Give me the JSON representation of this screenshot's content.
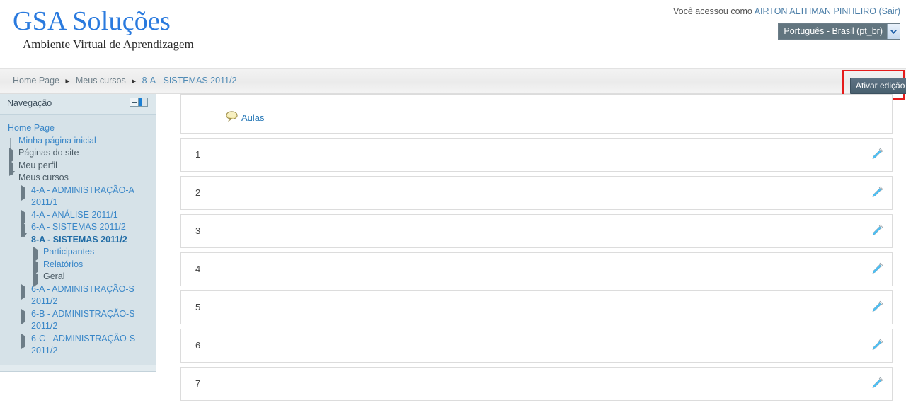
{
  "header": {
    "brand_title": "GSA Soluções",
    "brand_subtitle": "Ambiente Virtual de Aprendizagem",
    "login_prefix": "Você acessou como",
    "user_name": "AIRTON ALTHMAN PINHEIRO",
    "logout_label": "(Sair)",
    "language_selected": "Português - Brasil (pt_br)",
    "language_icon": "chevron-down-icon"
  },
  "breadcrumb": {
    "separator": "►",
    "items": [
      {
        "label": "Home Page",
        "type": "link"
      },
      {
        "label": "Meus cursos",
        "type": "link"
      },
      {
        "label": "8-A - SISTEMAS 2011/2",
        "type": "current"
      }
    ]
  },
  "toolbar": {
    "edit_button_label": "Ativar edição",
    "highlight_color": "#e51b1b"
  },
  "sidebar": {
    "block_title": "Navegação",
    "collapse_icon": "minus-icon",
    "dock_icon": "dock-icon",
    "items": [
      {
        "label": "Home Page",
        "level": 0,
        "twisty": "none",
        "style": "link"
      },
      {
        "label": "Minha página inicial",
        "level": 1,
        "twisty": "dot",
        "style": "link"
      },
      {
        "label": "Páginas do site",
        "level": 1,
        "twisty": "right",
        "style": "text"
      },
      {
        "label": "Meu perfil",
        "level": 1,
        "twisty": "right",
        "style": "text"
      },
      {
        "label": "Meus cursos",
        "level": 1,
        "twisty": "down",
        "style": "text"
      },
      {
        "label": "4-A - ADMINISTRAÇÃO-A 2011/1",
        "level": 2,
        "twisty": "right",
        "style": "link"
      },
      {
        "label": "4-A - ANÁLISE 2011/1",
        "level": 2,
        "twisty": "right",
        "style": "link"
      },
      {
        "label": "6-A - SISTEMAS 2011/2",
        "level": 2,
        "twisty": "right",
        "style": "link"
      },
      {
        "label": "8-A - SISTEMAS 2011/2",
        "level": 2,
        "twisty": "down",
        "style": "bold"
      },
      {
        "label": "Participantes",
        "level": 3,
        "twisty": "right",
        "style": "link"
      },
      {
        "label": "Relatórios",
        "level": 3,
        "twisty": "right",
        "style": "link"
      },
      {
        "label": "Geral",
        "level": 3,
        "twisty": "right",
        "style": "text"
      },
      {
        "label": "6-A - ADMINISTRAÇÃO-S 2011/2",
        "level": 2,
        "twisty": "right",
        "style": "link"
      },
      {
        "label": "6-B - ADMINISTRAÇÃO-S 2011/2",
        "level": 2,
        "twisty": "right",
        "style": "link"
      },
      {
        "label": "6-C - ADMINISTRAÇÃO-S 2011/2",
        "level": 2,
        "twisty": "right",
        "style": "link"
      }
    ]
  },
  "course": {
    "top_section": {
      "activity_label": "Aulas",
      "activity_icon": "forum-speech-bubble-icon"
    },
    "edit_icon": "pencil-icon",
    "sections": [
      {
        "number": "1"
      },
      {
        "number": "2"
      },
      {
        "number": "3"
      },
      {
        "number": "4"
      },
      {
        "number": "5"
      },
      {
        "number": "6"
      },
      {
        "number": "7"
      }
    ]
  },
  "colors": {
    "brand_blue": "#2a7ade",
    "link_blue": "#3a87c8",
    "sidebar_bg": "#d6e2e8",
    "edit_button_bg": "#4f6675",
    "highlight_red": "#e51b1b",
    "pencil_blue": "#1a9adf"
  }
}
